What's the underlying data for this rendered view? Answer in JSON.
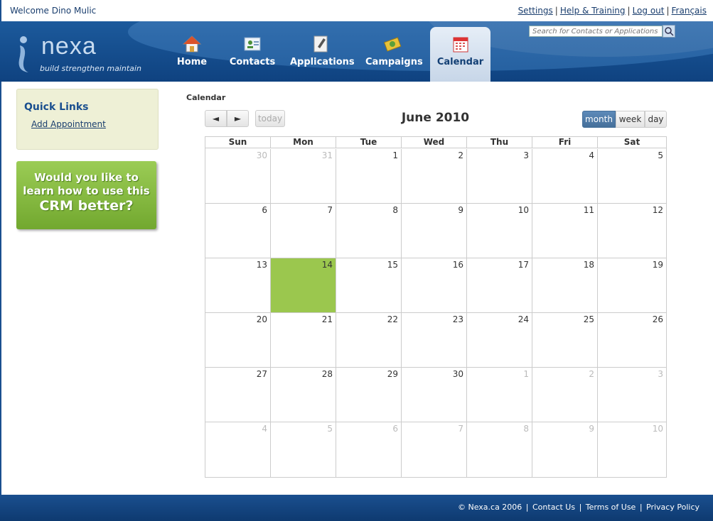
{
  "topbar": {
    "welcome": "Welcome Dino Mulic",
    "links": [
      "Settings",
      "Help & Training",
      "Log out",
      "Français"
    ]
  },
  "header": {
    "logo_text": "nexa",
    "logo_tagline": "build strengthen maintain",
    "search_placeholder": "Search for Contacts or Applications",
    "nav": [
      {
        "label": "Home",
        "icon": "home-icon"
      },
      {
        "label": "Contacts",
        "icon": "contacts-icon"
      },
      {
        "label": "Applications",
        "icon": "applications-icon"
      },
      {
        "label": "Campaigns",
        "icon": "campaigns-icon"
      },
      {
        "label": "Calendar",
        "icon": "calendar-icon",
        "active": true
      }
    ]
  },
  "sidebar": {
    "quick_links_title": "Quick Links",
    "add_appointment": "Add Appointment",
    "promo_lines": [
      "Would you like to",
      "learn how to use this",
      "CRM better?"
    ]
  },
  "calendar": {
    "label": "Calendar",
    "prev": "◄",
    "next": "►",
    "today": "today",
    "title": "June 2010",
    "views": [
      "month",
      "week",
      "day"
    ],
    "active_view": "month",
    "weekdays": [
      "Sun",
      "Mon",
      "Tue",
      "Wed",
      "Thu",
      "Fri",
      "Sat"
    ],
    "weeks": [
      [
        "30",
        "31",
        "1",
        "2",
        "3",
        "4",
        "5"
      ],
      [
        "6",
        "7",
        "8",
        "9",
        "10",
        "11",
        "12"
      ],
      [
        "13",
        "14",
        "15",
        "16",
        "17",
        "18",
        "19"
      ],
      [
        "20",
        "21",
        "22",
        "23",
        "24",
        "25",
        "26"
      ],
      [
        "27",
        "28",
        "29",
        "30",
        "1",
        "2",
        "3"
      ],
      [
        "4",
        "5",
        "6",
        "7",
        "8",
        "9",
        "10"
      ]
    ],
    "highlight_day": "14",
    "highlight_color": "#9bc74e"
  },
  "footer": {
    "links": [
      "© Nexa.ca 2006",
      "Contact Us",
      "Terms of Use",
      "Privacy Policy"
    ]
  }
}
